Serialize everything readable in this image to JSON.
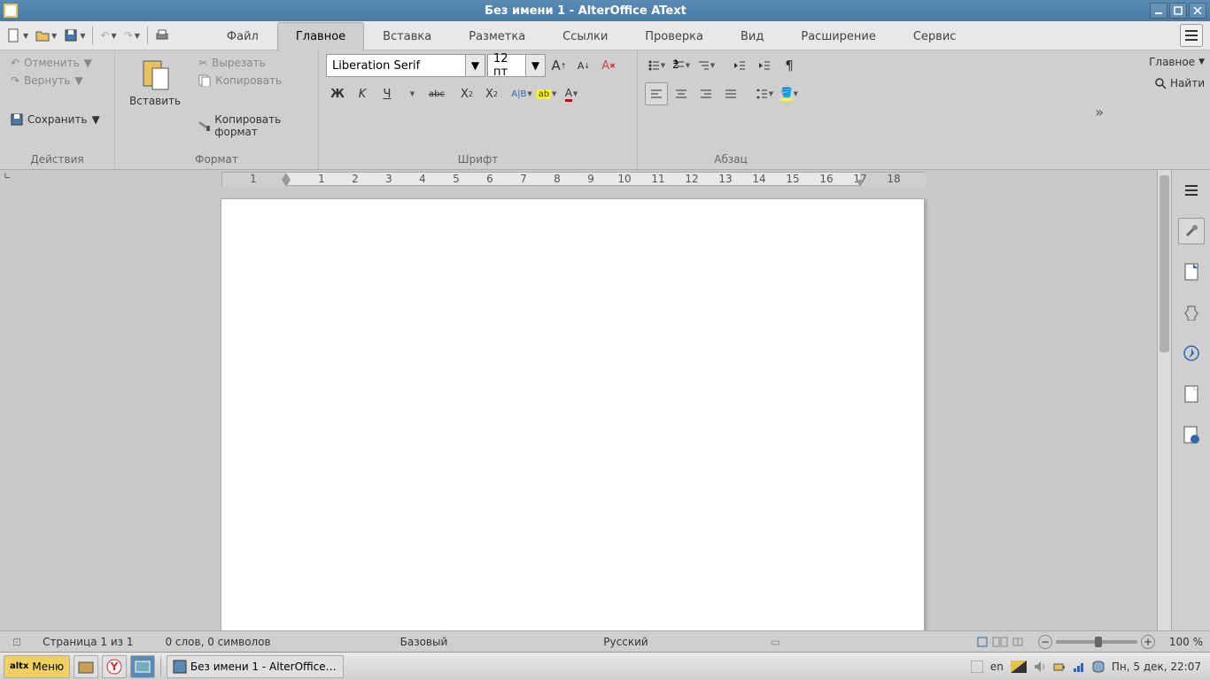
{
  "window": {
    "title": "Без имени 1 - AlterOffice AText"
  },
  "tabs": [
    "Файл",
    "Главное",
    "Вставка",
    "Разметка",
    "Ссылки",
    "Проверка",
    "Вид",
    "Расширение",
    "Сервис"
  ],
  "active_tab": 1,
  "actions": {
    "undo": "Отменить",
    "redo": "Вернуть",
    "save": "Сохранить",
    "paste": "Вставить",
    "cut": "Вырезать",
    "copy": "Копировать",
    "clone_fmt": "Копировать формат"
  },
  "groups": {
    "g1": "Действия",
    "g2": "Формат",
    "g3": "Шрифт",
    "g4": "Абзац"
  },
  "font": {
    "name": "Liberation Serif",
    "size": "12 пт"
  },
  "fmt_row1": {
    "bold": "Ж",
    "italic": "K",
    "underline": "Ч",
    "strike": "abc"
  },
  "rside": {
    "main": "Главное",
    "find": "Найти"
  },
  "ruler_nums": [
    "1",
    "1",
    "2",
    "3",
    "4",
    "5",
    "6",
    "7",
    "8",
    "9",
    "10",
    "11",
    "12",
    "13",
    "14",
    "15",
    "16",
    "17",
    "18"
  ],
  "status": {
    "page": "Страница 1 из 1",
    "words": "0 слов, 0 символов",
    "style": "Базовый",
    "lang": "Русский",
    "zoom": "100 %"
  },
  "taskbar": {
    "menu": "Меню",
    "app": "Без имени 1 - AlterOffice ...",
    "kb": "en",
    "clock": "Пн, 5 дек, 22:07"
  }
}
